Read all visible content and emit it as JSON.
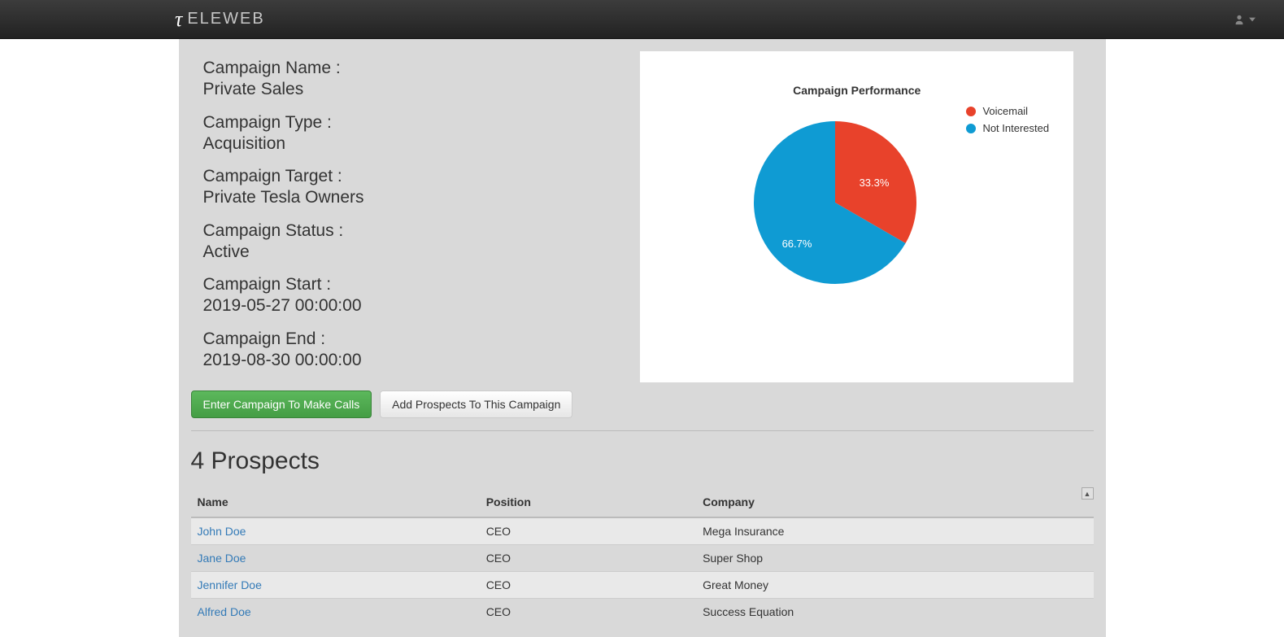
{
  "brand": "ELEWEB",
  "campaign": {
    "name_label": "Campaign Name :",
    "name_value": "Private Sales",
    "type_label": "Campaign Type :",
    "type_value": "Acquisition",
    "target_label": "Campaign Target :",
    "target_value": "Private Tesla Owners",
    "status_label": "Campaign Status :",
    "status_value": "Active",
    "start_label": "Campaign Start :",
    "start_value": "2019-05-27 00:00:00",
    "end_label": "Campaign End :",
    "end_value": "2019-08-30 00:00:00"
  },
  "buttons": {
    "enter": "Enter Campaign To Make Calls",
    "add": "Add Prospects To This Campaign"
  },
  "prospects": {
    "title": "4 Prospects",
    "headers": {
      "name": "Name",
      "position": "Position",
      "company": "Company"
    },
    "rows": [
      {
        "name": "John Doe",
        "position": "CEO",
        "company": "Mega Insurance"
      },
      {
        "name": "Jane Doe",
        "position": "CEO",
        "company": "Super Shop"
      },
      {
        "name": "Jennifer Doe",
        "position": "CEO",
        "company": "Great Money"
      },
      {
        "name": "Alfred Doe",
        "position": "CEO",
        "company": "Success Equation"
      }
    ]
  },
  "chart_data": {
    "type": "pie",
    "title": "Campaign Performance",
    "series": [
      {
        "name": "Voicemail",
        "value": 33.3,
        "label": "33.3%",
        "color": "#e8422b"
      },
      {
        "name": "Not Interested",
        "value": 66.7,
        "label": "66.7%",
        "color": "#0f9bd3"
      }
    ]
  }
}
